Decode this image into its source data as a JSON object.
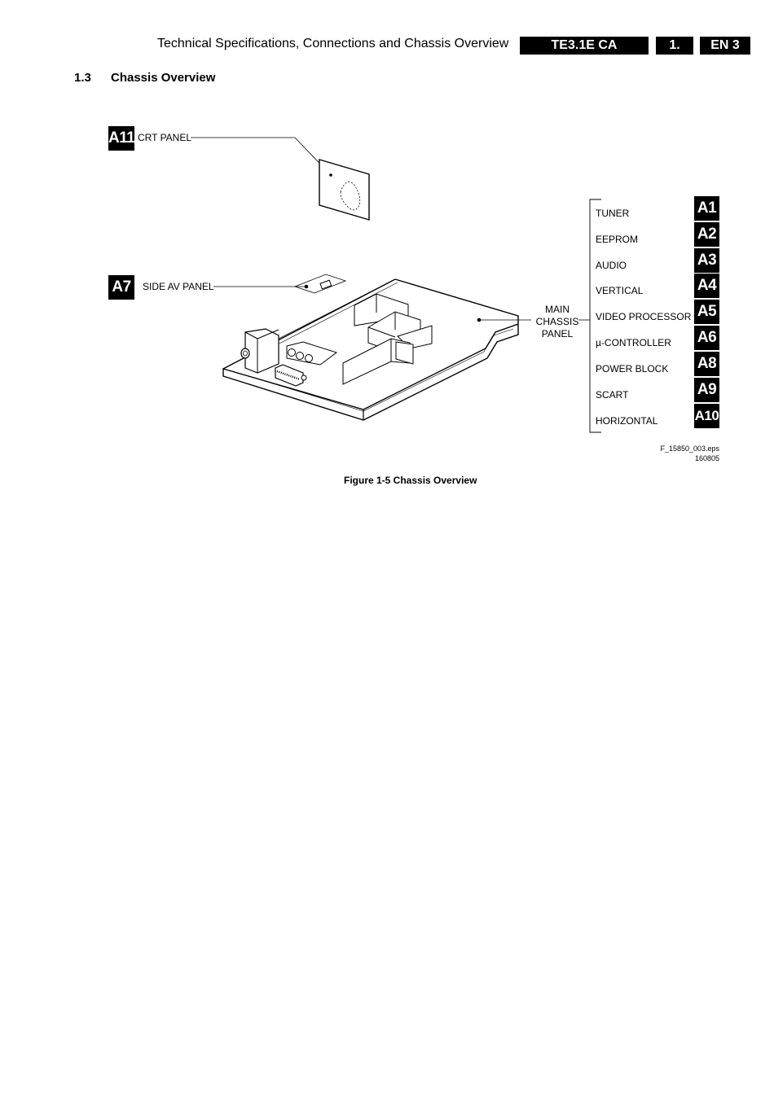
{
  "header": {
    "title": "Technical Specifications, Connections and Chassis Overview",
    "model": "TE3.1E CA",
    "chapter": "1.",
    "page": "EN 3"
  },
  "section": {
    "number": "1.3",
    "title": "Chassis Overview"
  },
  "figure": {
    "callouts": [
      {
        "badge": "A11",
        "label": "CRT PANEL"
      },
      {
        "badge": "A7",
        "label": "SIDE AV PANEL"
      }
    ],
    "main_panel_label": [
      "MAIN",
      "CHASSIS",
      "PANEL"
    ],
    "modules": [
      {
        "label": "TUNER",
        "badge": "A1"
      },
      {
        "label": "EEPROM",
        "badge": "A2"
      },
      {
        "label": "AUDIO",
        "badge": "A3"
      },
      {
        "label": "VERTICAL",
        "badge": "A4"
      },
      {
        "label": "VIDEO PROCESSOR",
        "badge": "A5"
      },
      {
        "label": "µ-CONTROLLER",
        "badge": "A6"
      },
      {
        "label": "POWER BLOCK",
        "badge": "A8"
      },
      {
        "label": "SCART",
        "badge": "A9"
      },
      {
        "label": "HORIZONTAL",
        "badge": "A10"
      }
    ],
    "file_ref": "F_15850_003.eps",
    "file_date": "160805",
    "caption": "Figure 1-5 Chassis Overview"
  }
}
